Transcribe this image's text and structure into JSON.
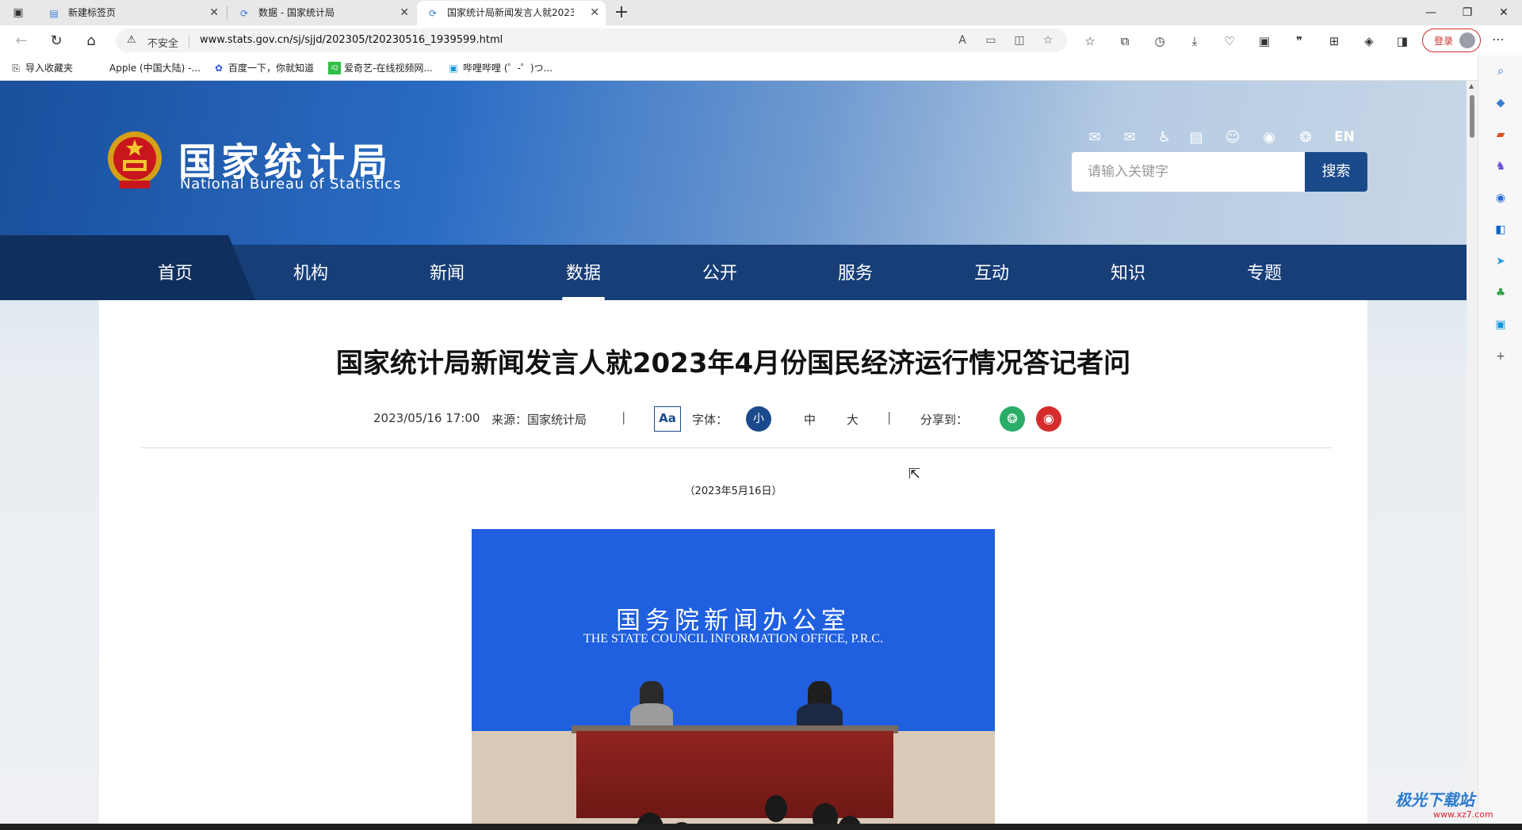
{
  "browser": {
    "tabs": [
      {
        "label": "新建标签页",
        "icon": "new-tab-page-icon"
      },
      {
        "label": "数据 - 国家统计局",
        "icon": "stats-favicon"
      },
      {
        "label": "国家统计局新闻发言人就2023年",
        "icon": "stats-favicon",
        "active": true
      }
    ],
    "new_tab": "+",
    "window_controls": [
      "—",
      "❐",
      "✕"
    ],
    "address": {
      "security_label": "不安全",
      "url": "www.stats.gov.cn/sj/sjjd/202305/t20230516_1939599.html"
    },
    "login_label": "登录",
    "favorites": [
      {
        "label": "导入收藏夹",
        "icon": "import-favorites-icon"
      },
      {
        "label": "Apple (中国大陆) -...",
        "icon": "apple-icon"
      },
      {
        "label": "百度一下，你就知道",
        "icon": "baidu-icon"
      },
      {
        "label": "爱奇艺-在线视频网...",
        "icon": "iqiyi-icon"
      },
      {
        "label": "哔哩哔哩 (゜-゜)つ...",
        "icon": "bilibili-icon"
      }
    ]
  },
  "site": {
    "logo_cn": "国家统计局",
    "logo_en": "National Bureau of Statistics",
    "header_en_link": "EN",
    "search": {
      "placeholder": "请输入关键字",
      "button": "搜索"
    },
    "nav": [
      "首页",
      "机构",
      "新闻",
      "数据",
      "公开",
      "服务",
      "互动",
      "知识",
      "专题"
    ],
    "active_nav": "数据"
  },
  "article": {
    "title": "国家统计局新闻发言人就2023年4月份国民经济运行情况答记者问",
    "datetime": "2023/05/16 17:00",
    "source": "来源：国家统计局",
    "aa": "Aa",
    "font_label": "字体：",
    "font_sizes": [
      "小",
      "中",
      "大"
    ],
    "share_label": "分享到：",
    "date_line": "（2023年5月16日）",
    "photo": {
      "backdrop_cn": "国务院新闻办公室",
      "backdrop_en": "THE STATE COUNCIL INFORMATION OFFICE, P.R.C."
    }
  },
  "watermark": {
    "text": "极光下载站",
    "sub": "www.xz7.com"
  },
  "colors": {
    "nav_bg": "#173e77",
    "accent": "#1b4a8a",
    "wechat": "#2aae67",
    "weibo": "#d52c2b",
    "login": "#c9302c"
  }
}
